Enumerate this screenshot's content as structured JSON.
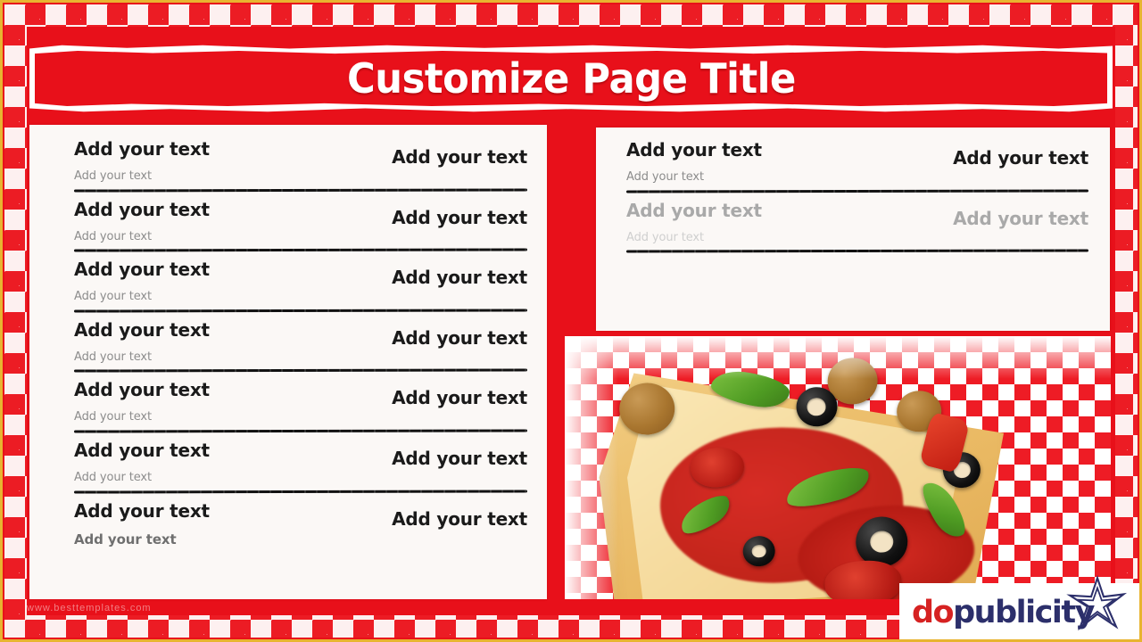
{
  "page": {
    "title": "Customize Page Title",
    "watermark": "www.besttemplates.com",
    "colors": {
      "red": "#e8101a",
      "gold": "#e8b430",
      "panel": "#fbf8f6",
      "text": "#1a1a1a",
      "muted": "#8c8c8c",
      "disabled": "#a9a9a9",
      "logo_do": "#d62222",
      "logo_publicity": "#2c2f6b"
    }
  },
  "left_panel": {
    "rows": [
      {
        "name": "Add your text",
        "desc": "Add your text",
        "price": "Add your text"
      },
      {
        "name": "Add your text",
        "desc": "Add your text",
        "price": "Add your text"
      },
      {
        "name": "Add your text",
        "desc": "Add your text",
        "price": "Add your text"
      },
      {
        "name": "Add your text",
        "desc": "Add your text",
        "price": "Add your text"
      },
      {
        "name": "Add your text",
        "desc": "Add your text",
        "price": "Add your text"
      },
      {
        "name": "Add your text",
        "desc": "Add your text",
        "price": "Add your text"
      },
      {
        "name": "Add your text",
        "desc": "Add your text",
        "price": "Add your text"
      }
    ]
  },
  "right_panel": {
    "rows": [
      {
        "name": "Add your text",
        "desc": "Add your text",
        "price": "Add your text"
      },
      {
        "name": "Add your text",
        "desc": "Add your text",
        "price": "Add your text"
      }
    ]
  },
  "logo": {
    "part1": "do",
    "part2": "publicity",
    "icon": "star-icon"
  },
  "image": {
    "alt": "pizza-slice-photo",
    "toppings": [
      "green-pepper",
      "black-olive",
      "sausage",
      "pepperoni",
      "red-pepper"
    ]
  }
}
